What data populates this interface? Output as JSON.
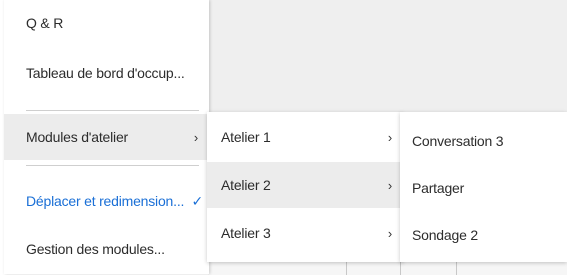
{
  "main_menu": {
    "items": [
      {
        "label": "Q & R"
      },
      {
        "label": "Tableau de bord d'occup..."
      },
      {
        "label": "Modules d'atelier",
        "submenu_indicator": "›"
      },
      {
        "label": "Déplacer et redimension...",
        "checkmark": "✓"
      },
      {
        "label": "Gestion des modules..."
      }
    ]
  },
  "submenu_ateliers": {
    "items": [
      {
        "label": "Atelier 1",
        "submenu_indicator": "›"
      },
      {
        "label": "Atelier 2",
        "submenu_indicator": "›"
      },
      {
        "label": "Atelier 3",
        "submenu_indicator": "›"
      }
    ]
  },
  "submenu_modules": {
    "items": [
      {
        "label": "Conversation 3"
      },
      {
        "label": "Partager"
      },
      {
        "label": "Sondage 2"
      }
    ]
  },
  "colors": {
    "accent": "#1a6fd6",
    "hover_bg": "#ececec",
    "app_bg": "#efefef"
  }
}
